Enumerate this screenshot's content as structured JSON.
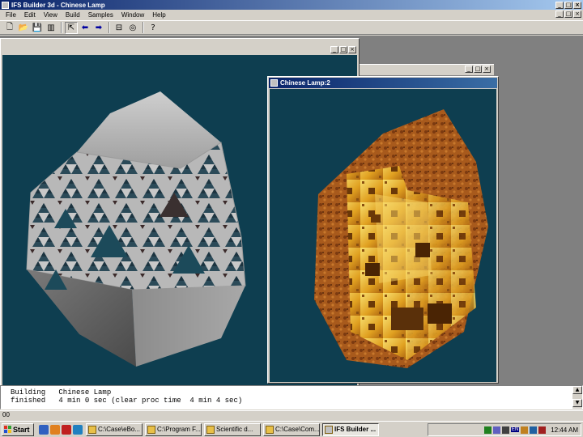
{
  "app": {
    "title": "IFS Builder 3d - Chinese Lamp"
  },
  "menu": [
    "File",
    "Edit",
    "View",
    "Build",
    "Samples",
    "Window",
    "Help"
  ],
  "toolbar": {
    "buttons": [
      {
        "icon": "new-file-icon",
        "glyph": "🗋"
      },
      {
        "icon": "open-folder-icon",
        "glyph": "📂"
      },
      {
        "icon": "save-icon",
        "glyph": "💾"
      },
      {
        "icon": "save-all-icon",
        "glyph": "▥"
      },
      {
        "icon": "select-tool-icon",
        "glyph": "⇱"
      },
      {
        "icon": "back-arrow-icon",
        "glyph": "⬅"
      },
      {
        "icon": "forward-arrow-icon",
        "glyph": "➡"
      },
      {
        "icon": "build-icon",
        "glyph": "⊟"
      },
      {
        "icon": "render-icon",
        "glyph": "◎"
      },
      {
        "icon": "help-icon",
        "glyph": "?"
      }
    ]
  },
  "windows": {
    "main_view": {
      "bg": "#0e3e50"
    },
    "second_view": {
      "title": "Chinese Lamp:2",
      "bg": "#0e3e50"
    }
  },
  "output": {
    "lines": [
      "Building   Chinese Lamp",
      "finished   4 min 0 sec (clear proc time  4 min 4 sec)"
    ]
  },
  "status": {
    "text": "00"
  },
  "taskbar": {
    "start_label": "Start",
    "tasks": [
      {
        "label": "C:\\Case\\eBo..."
      },
      {
        "label": "C:\\Program F..."
      },
      {
        "label": "Scientific d..."
      },
      {
        "label": "C:\\Case\\Com..."
      },
      {
        "label": "IFS Builder ...",
        "active": true
      },
      {
        "label": "..."
      }
    ],
    "tray": {
      "lang": "EN",
      "clock": "12:44 AM"
    }
  }
}
